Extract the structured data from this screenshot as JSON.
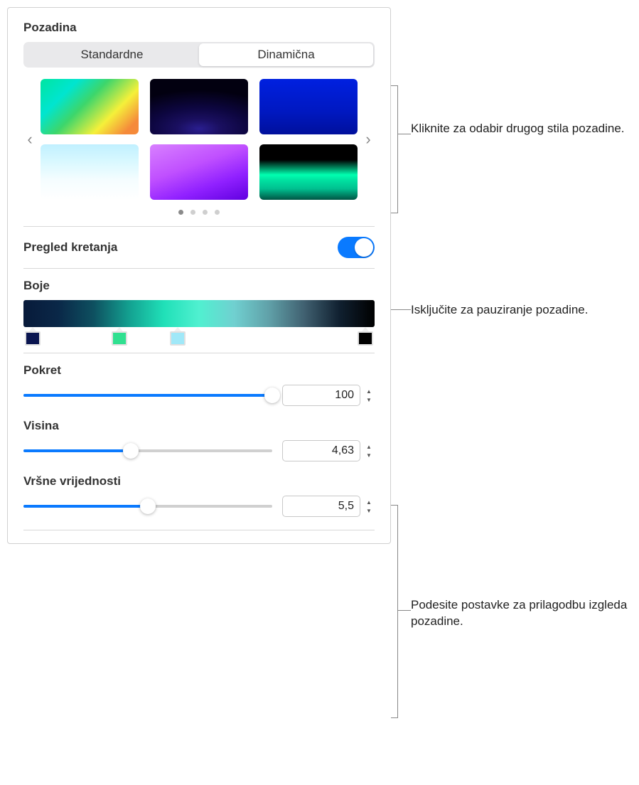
{
  "background": {
    "title": "Pozadina",
    "tabs": {
      "standard": "Standardne",
      "dynamic": "Dinamična"
    },
    "page_dots": 4,
    "active_dot": 0
  },
  "motion_preview": {
    "label": "Pregled kretanja",
    "on": true
  },
  "colors": {
    "label": "Boje",
    "stops": [
      "#0a1550",
      "#30e090",
      "#a0e8f8",
      "#000000"
    ]
  },
  "sliders": {
    "pokret": {
      "label": "Pokret",
      "value": "100",
      "percent": 100
    },
    "visina": {
      "label": "Visina",
      "value": "4,63",
      "percent": 43
    },
    "vrsne": {
      "label": "Vršne vrijednosti",
      "value": "5,5",
      "percent": 50
    }
  },
  "callouts": {
    "c1": "Kliknite za odabir drugog stila pozadine.",
    "c2": "Isključite za pauziranje pozadine.",
    "c3": "Podesite postavke za prilagodbu izgleda pozadine."
  }
}
